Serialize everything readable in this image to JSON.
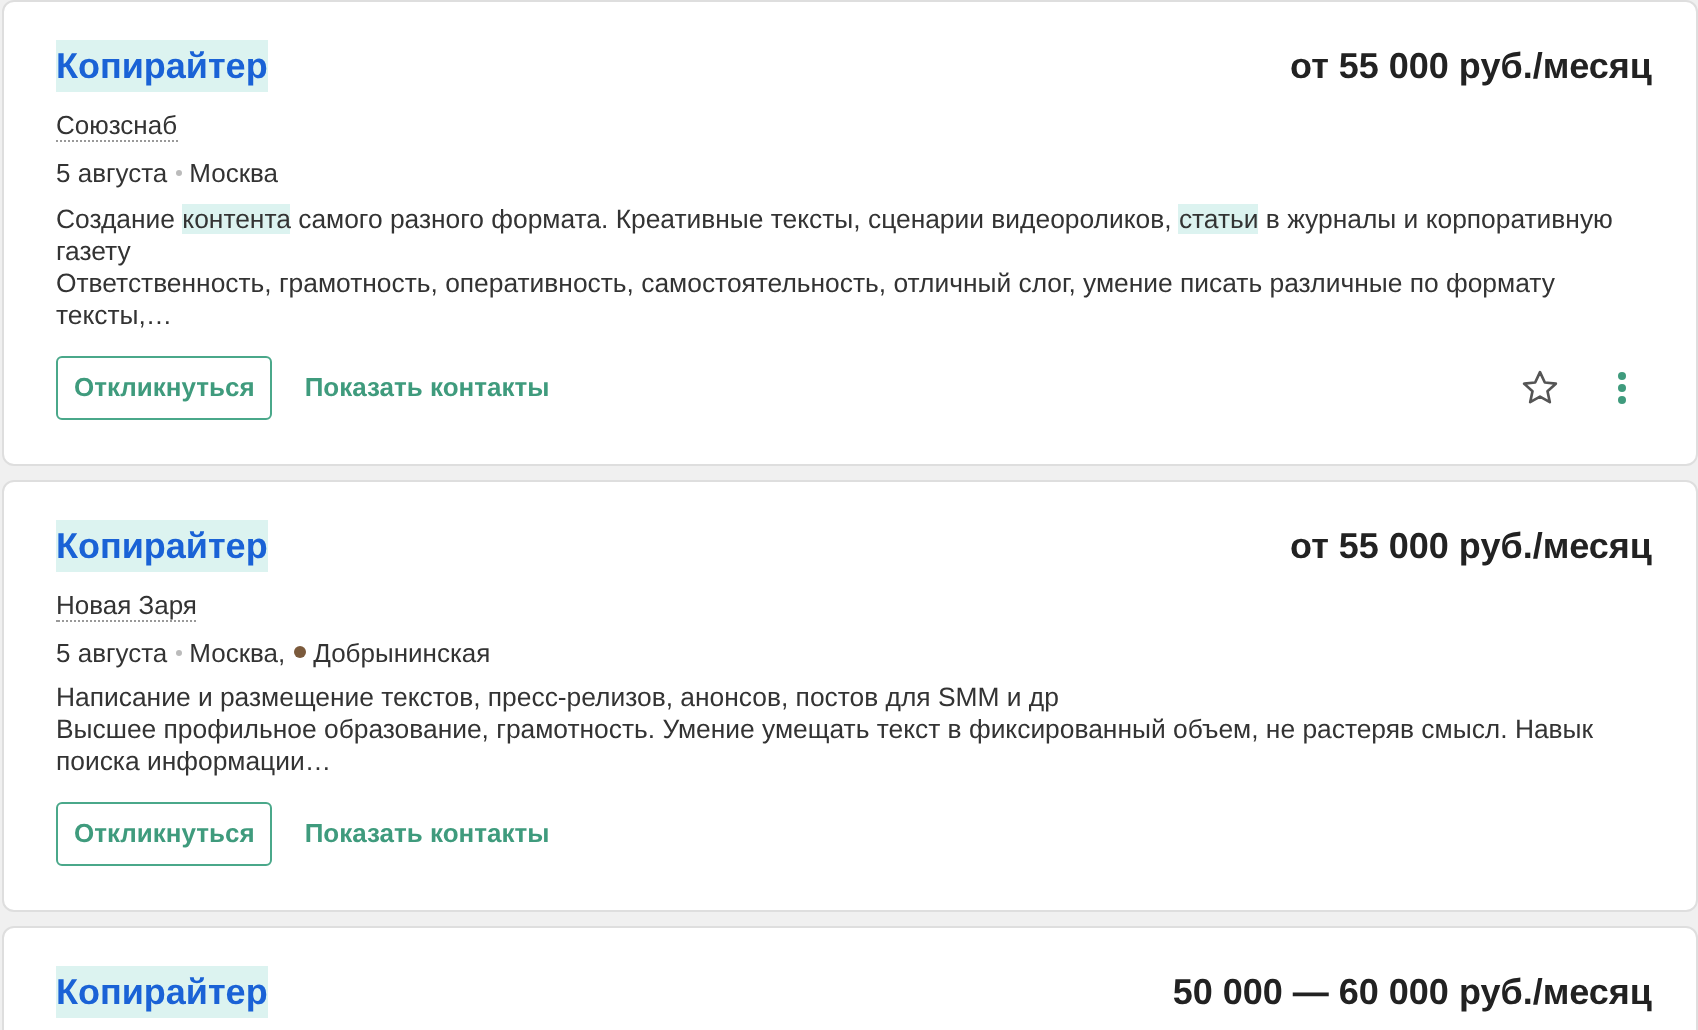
{
  "vacancies": [
    {
      "title": "Копирайтер",
      "title_highlighted": true,
      "salary": "от 55 000 руб./месяц",
      "company": "Союзснаб",
      "date": "5 августа",
      "city": "Москва",
      "description": [
        [
          {
            "text": "Создание ",
            "highlighted": false
          },
          {
            "text": "контента",
            "highlighted": true
          },
          {
            "text": " самого разного формата. Креативные тексты, сценарии видеороликов, ",
            "highlighted": false
          },
          {
            "text": "статьи",
            "highlighted": true
          },
          {
            "text": " в журналы и корпоративную газету",
            "highlighted": false
          }
        ],
        [
          {
            "text": "Ответственность, грамотность, оперативность, самостоятельность, отличный слог, умение писать различные по формату тексты,…",
            "highlighted": false
          }
        ]
      ],
      "buttons": {
        "respond": "Откликнуться",
        "contacts": "Показать контакты"
      },
      "actions": true
    },
    {
      "title": "Копирайтер",
      "title_highlighted": true,
      "salary": "от 55 000 руб./месяц",
      "company": "Новая Заря",
      "date": "5 августа",
      "city": "Москва,",
      "metro": {
        "name": "Добрынинская",
        "color": "#7b5a3c"
      },
      "description": [
        [
          {
            "text": "Написание и размещение текстов, пресс-релизов, анонсов, постов для SMM и др",
            "highlighted": false
          }
        ],
        [
          {
            "text": "Высшее профильное образование, грамотность. Умение умещать текст в фиксированный объем, не растеряв смысл. Навык поиска информации…",
            "highlighted": false
          }
        ]
      ],
      "buttons": {
        "respond": "Откликнуться",
        "contacts": "Показать контакты"
      },
      "actions": false
    },
    {
      "title": "Копирайтер",
      "title_highlighted": true,
      "salary": "50 000 — 60 000 руб./месяц"
    }
  ]
}
